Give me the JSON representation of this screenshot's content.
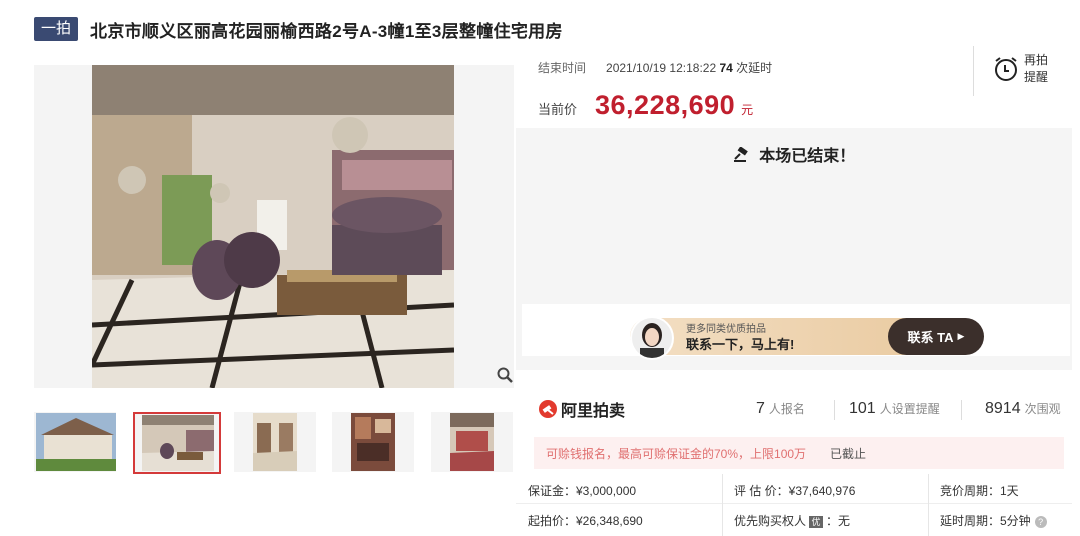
{
  "header": {
    "tag": "一拍",
    "title": "北京市顺义区丽高花园丽榆西路2号A-3幢1至3层整幢住宅用房"
  },
  "auction": {
    "end_label": "结束时间",
    "end_time": "2021/10/19 12:18:22",
    "delay_count": "74",
    "delay_suffix": "次延时",
    "price_label": "当前价",
    "current_price": "36,228,690",
    "price_unit": "元",
    "remind_label_1": "再拍",
    "remind_label_2": "提醒",
    "ended_text": "本场已结束！"
  },
  "banner": {
    "sub": "更多同类优质拍品",
    "main": "联系一下，马上有!",
    "button": "联系 TA"
  },
  "stats": {
    "logo": "阿里拍卖",
    "signups": "7",
    "signups_label": "人报名",
    "reminders": "101",
    "reminders_label": "人设置提醒",
    "views": "8914",
    "views_label": "次围观"
  },
  "notice": {
    "text": "可赊钱报名，最高可赊保证金的70%，上限100万",
    "status": "已截止"
  },
  "details": {
    "deposit": "保证金：¥3,000,000",
    "appraisal": "评 估 价：¥37,640,976",
    "cycle": "竞价周期：1天",
    "start_price": "起拍价：¥26,348,690",
    "priority_label": "优先购买权人",
    "priority_icon": "优",
    "priority_value": "：无",
    "delay_cycle": "延时周期：5分钟"
  },
  "colors": {
    "accent": "#c01f2e",
    "tag": "#3a4a72"
  }
}
